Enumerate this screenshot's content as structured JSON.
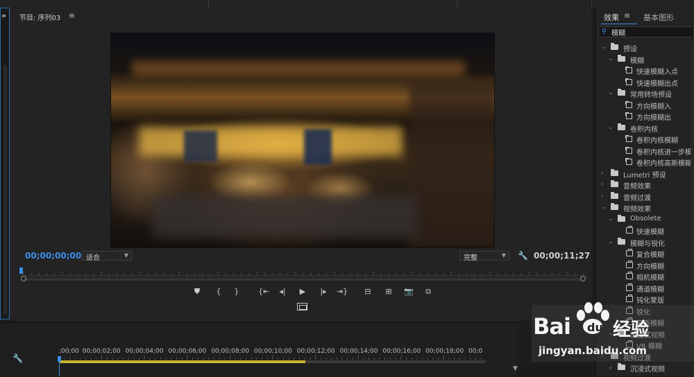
{
  "program_monitor": {
    "title": "节目: 序列03",
    "menu_icon": "hamburger-menu-icon",
    "timecode_current": "00;00;00;00",
    "fit_select": "适合",
    "quality_select": "完整",
    "timecode_duration": "00;00;11;27",
    "settings_icon": "wrench-icon",
    "controls": [
      {
        "name": "add-marker-button",
        "glyph": "⛊",
        "icon": "marker-icon"
      },
      {
        "name": "mark-in-button",
        "glyph": "{",
        "icon": "mark-in-icon"
      },
      {
        "name": "mark-out-button",
        "glyph": "}",
        "icon": "mark-out-icon"
      },
      {
        "name": "go-to-in-button",
        "glyph": "{⇤",
        "icon": "go-to-in-icon"
      },
      {
        "name": "step-back-button",
        "glyph": "◂|",
        "icon": "step-back-icon"
      },
      {
        "name": "play-button",
        "glyph": "▶",
        "icon": "play-icon"
      },
      {
        "name": "step-forward-button",
        "glyph": "|▸",
        "icon": "step-forward-icon"
      },
      {
        "name": "go-to-out-button",
        "glyph": "⇥}",
        "icon": "go-to-out-icon"
      },
      {
        "name": "lift-button",
        "glyph": "⊟",
        "icon": "lift-icon"
      },
      {
        "name": "extract-button",
        "glyph": "⊞",
        "icon": "extract-icon"
      },
      {
        "name": "export-frame-button",
        "glyph": "📷",
        "icon": "camera-icon"
      },
      {
        "name": "comparison-view-button",
        "glyph": "⧉",
        "icon": "comparison-view-icon"
      }
    ],
    "safe_margins_icon": "safe-margins-icon"
  },
  "timeline": {
    "tool_icon": "wrench-icon",
    "labels": [
      ";00;00",
      "00;00;02;00",
      "00;00;04;00",
      "00;00;06;00",
      "00;00;08;00",
      "00;00;10;00",
      "00;00;12;00",
      "00;00;14;00",
      "00;00;16;00",
      "00;00;18;00",
      "00;0"
    ],
    "work_area_end_fraction": 0.577
  },
  "effects_panel": {
    "tab_effects": "效果",
    "tab_menu_icon": "hamburger-menu-icon",
    "tab_basic": "基本图形",
    "search_icon": "search-icon",
    "search_value": "模糊",
    "tree": [
      {
        "level": 0,
        "type": "folder",
        "expanded": true,
        "label": "预设"
      },
      {
        "level": 1,
        "type": "folder",
        "expanded": true,
        "label": "模糊"
      },
      {
        "level": 2,
        "type": "preset",
        "label": "快速模糊入点"
      },
      {
        "level": 2,
        "type": "preset",
        "label": "快速模糊出点"
      },
      {
        "level": 1,
        "type": "folder",
        "expanded": true,
        "label": "常用转场预设"
      },
      {
        "level": 2,
        "type": "preset",
        "label": "方向模糊入"
      },
      {
        "level": 2,
        "type": "preset",
        "label": "方向模糊出"
      },
      {
        "level": 1,
        "type": "folder",
        "expanded": true,
        "label": "卷积内核"
      },
      {
        "level": 2,
        "type": "preset",
        "label": "卷积内核模糊"
      },
      {
        "level": 2,
        "type": "preset",
        "label": "卷积内核进一步模"
      },
      {
        "level": 2,
        "type": "preset",
        "label": "卷积内核高斯模糊"
      },
      {
        "level": 0,
        "type": "folder",
        "expanded": false,
        "label": "Lumetri 预设"
      },
      {
        "level": 0,
        "type": "folder",
        "expanded": false,
        "label": "音频效果"
      },
      {
        "level": 0,
        "type": "folder",
        "expanded": false,
        "label": "音频过渡"
      },
      {
        "level": 0,
        "type": "folder",
        "expanded": true,
        "label": "视频效果"
      },
      {
        "level": 1,
        "type": "folder",
        "expanded": true,
        "label": "Obsolete"
      },
      {
        "level": 2,
        "type": "fx",
        "label": "快速模糊"
      },
      {
        "level": 1,
        "type": "folder",
        "expanded": true,
        "label": "模糊与锐化"
      },
      {
        "level": 2,
        "type": "fx",
        "label": "复合模糊"
      },
      {
        "level": 2,
        "type": "fx",
        "label": "方向模糊"
      },
      {
        "level": 2,
        "type": "fx",
        "label": "相机模糊"
      },
      {
        "level": 2,
        "type": "fx",
        "label": "通道模糊"
      },
      {
        "level": 2,
        "type": "fx",
        "label": "钝化蒙版"
      },
      {
        "level": 2,
        "type": "fx",
        "label": "锐化"
      },
      {
        "level": 2,
        "type": "fx",
        "label": "高斯模糊"
      },
      {
        "level": 1,
        "type": "folder",
        "expanded": true,
        "label": "沉浸式视频"
      },
      {
        "level": 2,
        "type": "fx",
        "label": "VR 模糊"
      },
      {
        "level": 0,
        "type": "folder",
        "expanded": false,
        "label": "视频过渡"
      },
      {
        "level": 1,
        "type": "folder",
        "expanded": true,
        "label": "沉浸式视频"
      }
    ]
  },
  "watermark": {
    "brand": "Bai",
    "brand2": "du",
    "cn": "经验",
    "url": "jingyan.baidu.com"
  },
  "colors": {
    "accent": "#3d8ee8",
    "work_area": "#c9b62a",
    "panel": "#232323"
  }
}
